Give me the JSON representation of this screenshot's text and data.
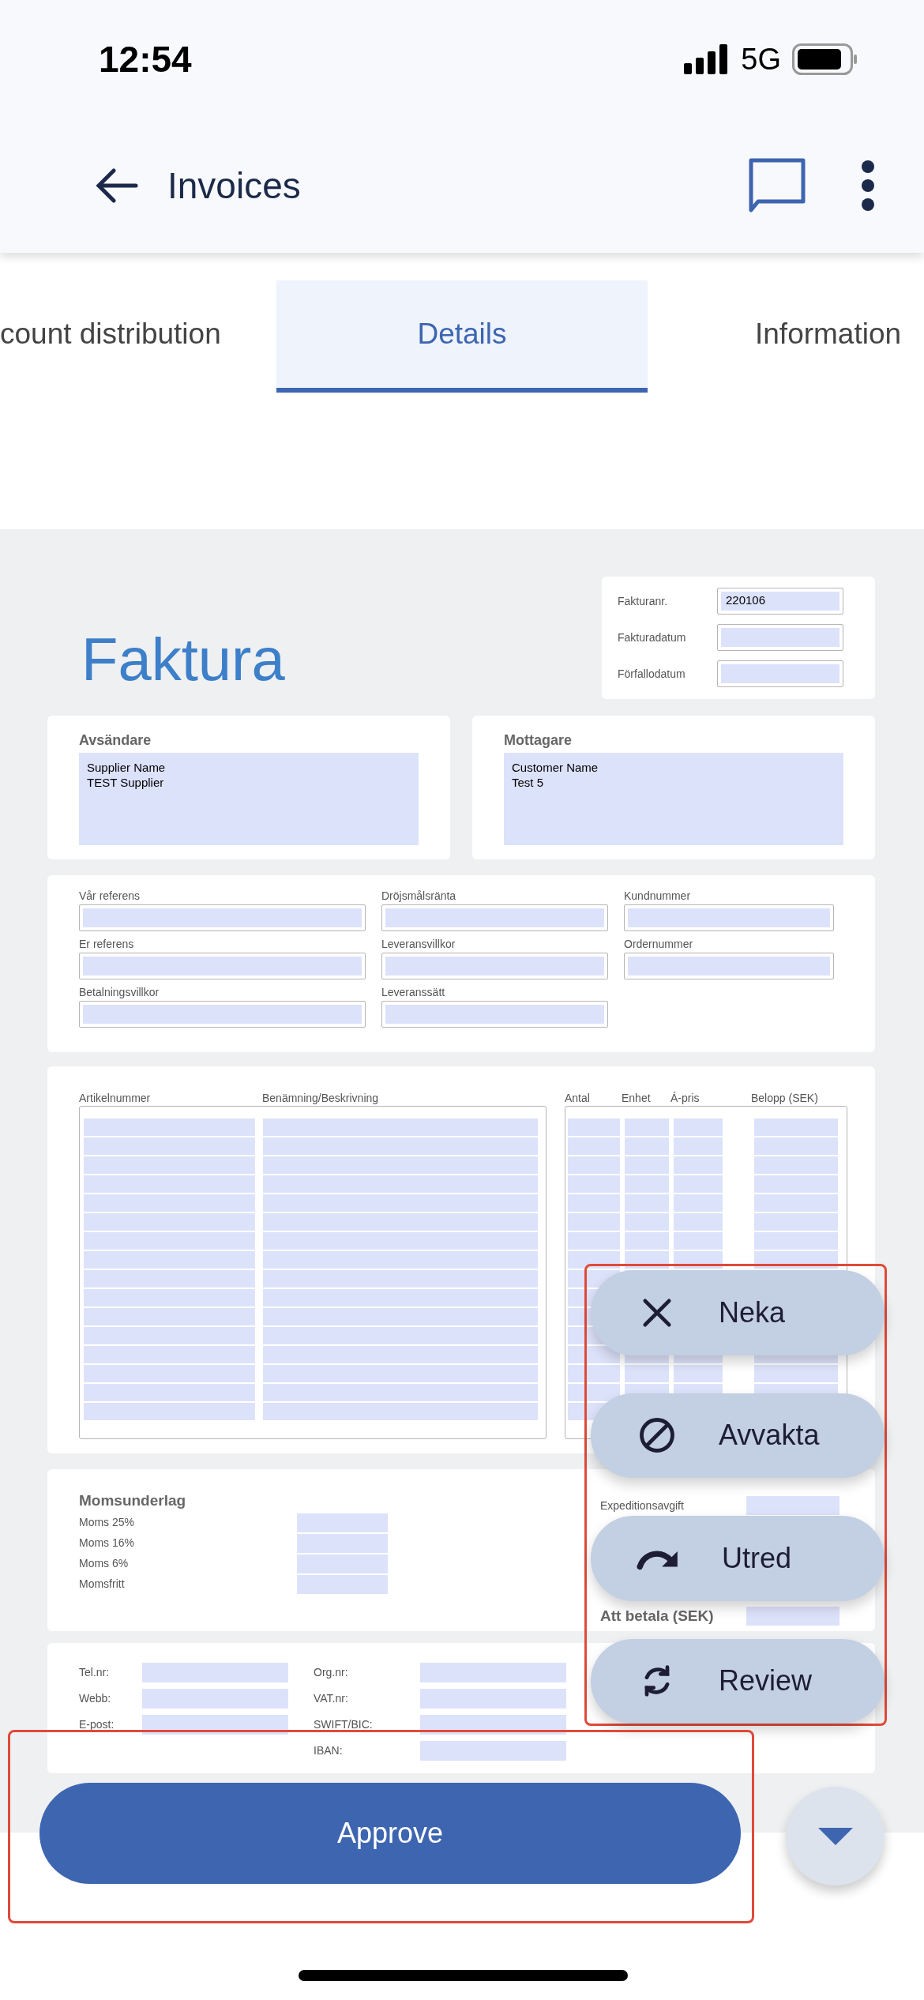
{
  "status_bar": {
    "time": "12:54",
    "network": "5G"
  },
  "header": {
    "title": "Invoices"
  },
  "tabs": [
    {
      "label": "count distribution",
      "selected": false
    },
    {
      "label": "Details",
      "selected": true
    },
    {
      "label": "Information",
      "selected": false
    }
  ],
  "invoice": {
    "title": "Faktura",
    "meta": [
      {
        "label": "Fakturanr.",
        "value": "220106"
      },
      {
        "label": "Fakturadatum"
      },
      {
        "label": "Förfallodatum"
      }
    ],
    "parties": [
      {
        "label": "Avsändare",
        "value": "Supplier Name\nTEST Supplier"
      },
      {
        "label": "Mottagare",
        "value": "Customer Name\nTest 5"
      }
    ],
    "references": [
      {
        "label": "Vår referens"
      },
      {
        "label": "Dröjsmålsränta"
      },
      {
        "label": "Kundnummer"
      },
      {
        "label": "Er referens"
      },
      {
        "label": "Leveransvillkor"
      },
      {
        "label": "Ordernummer"
      },
      {
        "label": "Betalningsvillkor"
      },
      {
        "label": "Leveranssätt"
      }
    ],
    "line_items": {
      "columns": [
        "Artikelnummer",
        "Benämning/Beskrivning",
        "Antal",
        "Enhet",
        "Á-pris",
        "Belopp (SEK)"
      ]
    },
    "vat": {
      "title": "Momsunderlag",
      "rows": [
        "Moms 25%",
        "Moms 16%",
        "Moms 6%",
        "Momsfritt"
      ]
    },
    "totals": [
      {
        "label": "Expeditionsavgift",
        "kind": "fee"
      },
      {
        "label": "Att betala (SEK)",
        "kind": "total"
      }
    ],
    "contact": [
      [
        "Tel.nr:",
        "Webb:",
        "E-post:"
      ],
      [
        "Org.nr:",
        "VAT.nr:",
        "SWIFT/BIC:",
        "IBAN:"
      ]
    ]
  },
  "actions": [
    {
      "label": "Neka",
      "kind": "reject"
    },
    {
      "label": "Avvakta",
      "kind": "hold"
    },
    {
      "label": "Utred",
      "kind": "investigate"
    },
    {
      "label": "Review",
      "kind": "review"
    }
  ],
  "approve_button": "Approve"
}
